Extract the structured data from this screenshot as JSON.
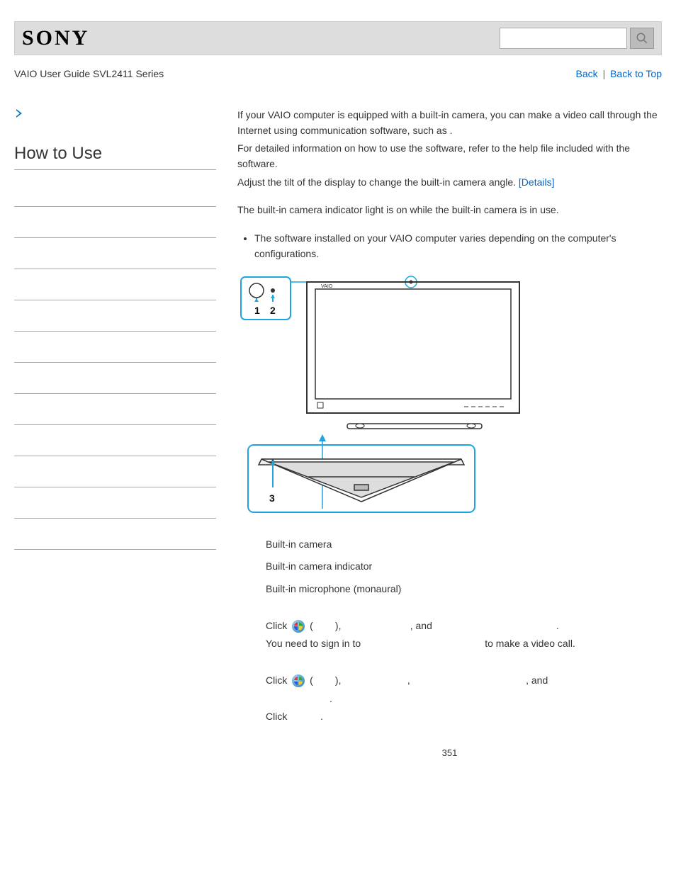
{
  "header": {
    "logo_text": "Sony",
    "search_placeholder": ""
  },
  "subheader": {
    "guide_title": "VAIO User Guide SVL2411 Series",
    "back_label": "Back",
    "back_to_top_label": "Back to Top",
    "separator": "|"
  },
  "sidebar": {
    "section_title": "How to Use"
  },
  "body": {
    "intro_prefix": "If your VAIO computer is equipped with a built-in camera, you can make a video call through the Internet using communication software, such as ",
    "intro_suffix": ".",
    "line2": "For detailed information on how to use the software, refer to the help file included with the software.",
    "line3_prefix": "Adjust the tilt of the display to change the built-in camera angle. ",
    "details_link": "[Details]",
    "line4": "The built-in camera indicator light is on while the built-in camera is in use.",
    "note_bullet": "The software installed on your VAIO computer varies depending on the computer's configurations."
  },
  "callouts": [
    "Built-in camera",
    "Built-in camera indicator",
    "Built-in microphone (monaural)"
  ],
  "steps": {
    "s1": {
      "click": "Click ",
      "paren_open": " (",
      "paren_close": "), ",
      "comma_and": ", and ",
      "period": ".",
      "l2a": "You need to sign in to ",
      "l2b": " to make a video call."
    },
    "s2": {
      "click": "Click ",
      "paren_open": " (",
      "paren_close": "), ",
      "comma": ", ",
      "comma_and": ", and",
      "period": ".",
      "l2": "Click ",
      "l2_period": "."
    }
  },
  "page_number": "351"
}
